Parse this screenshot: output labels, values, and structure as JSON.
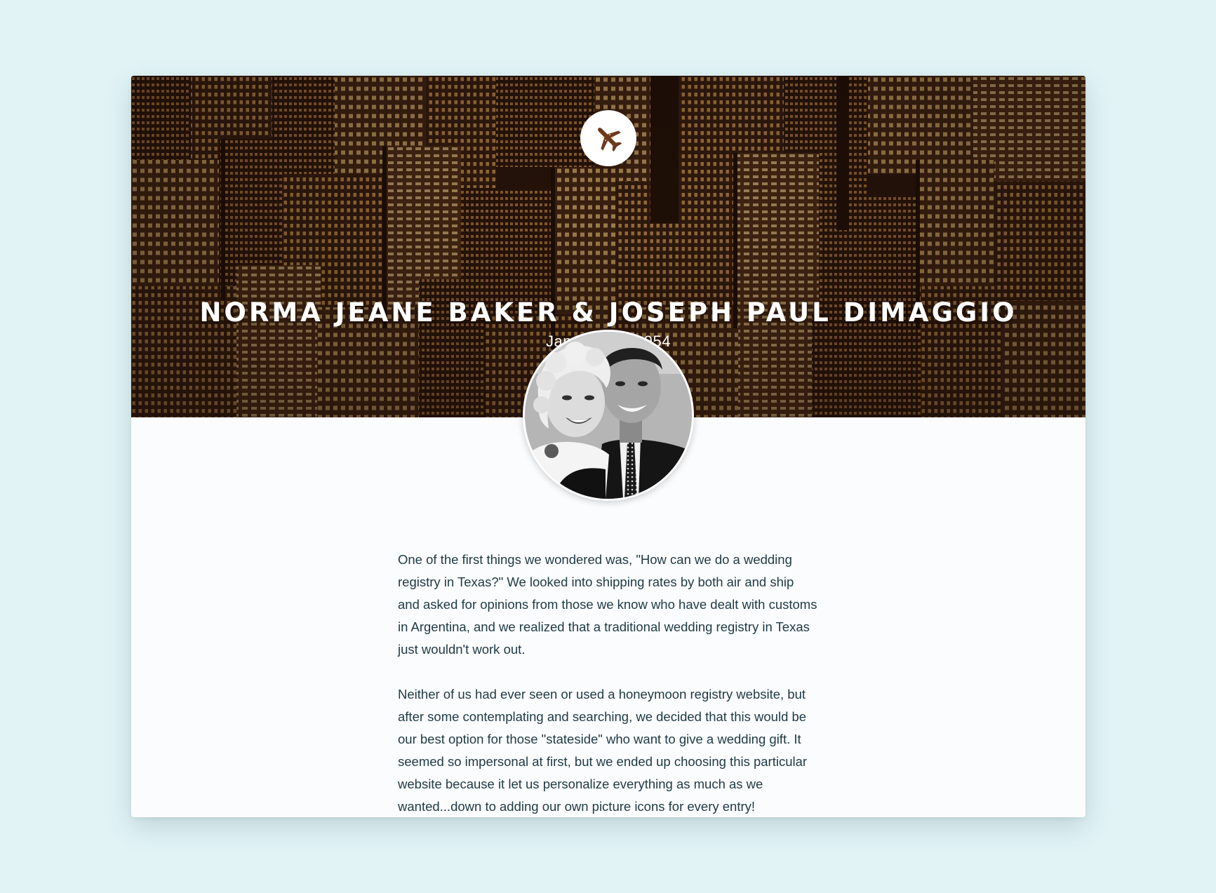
{
  "hero": {
    "icon": "airplane-icon",
    "title": "NORMA JEANE BAKER & JOSEPH PAUL DIMAGGIO",
    "date": "January 14, 1954"
  },
  "avatar": {
    "label": "couple-photo"
  },
  "story": {
    "paragraphs": [
      "One of the first things we wondered was, \"How can we do a wedding registry in Texas?\" We looked into shipping rates by both air and ship and asked for opinions from those we know who have dealt with customs in Argentina, and we realized that a traditional wedding registry in Texas just wouldn't work out.",
      "Neither of us had ever seen or used a honeymoon registry website, but after some contemplating and searching, we decided that this would be our best option for those \"stateside\" who want to give a wedding gift. It seemed so impersonal at first, but we ended up choosing this particular website because it let us personalize everything as much as we wanted...down to adding our own picture icons for every entry!"
    ]
  },
  "colors": {
    "page_background": "#e1f3f5",
    "card_background": "#fbfcfd",
    "body_text": "#1e3a44",
    "hero_tone": "#6b3a1c"
  }
}
